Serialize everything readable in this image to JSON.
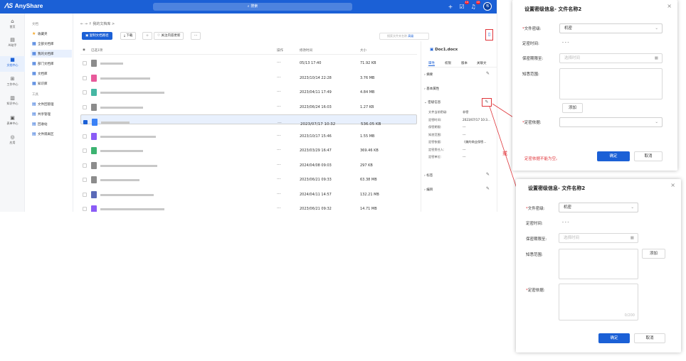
{
  "app": {
    "logo": "AnyShare",
    "search_placeholder": "搜索",
    "badges": [
      "14",
      "10"
    ],
    "avatar": "韦",
    "colors": {
      "brand": "#1b60d6",
      "highlight": "#e0353a"
    }
  },
  "rail": [
    {
      "label": "首页",
      "icon": "home-icon"
    },
    {
      "label": "AI助手",
      "icon": "ai-icon"
    },
    {
      "label": "文档中心",
      "icon": "folder-icon",
      "active": true
    },
    {
      "label": "工作中心",
      "icon": "grid-icon"
    },
    {
      "label": "知识中心",
      "icon": "book-icon"
    },
    {
      "label": "表单中心",
      "icon": "form-icon"
    },
    {
      "label": "应用",
      "icon": "apps-icon"
    }
  ],
  "tree": {
    "section_docs": "文档",
    "docs": [
      "收藏夹",
      "全部文档库",
      "我的文档库",
      "部门文档库",
      "文档库",
      "知识库"
    ],
    "active_index": 2,
    "section_tools": "工具",
    "tools": [
      "文件回管理",
      "共享管理",
      "回收站",
      "文件隔离区"
    ]
  },
  "main": {
    "breadcrumb": "我的文档库 >",
    "toolbar": {
      "new_label": "复制文档路径",
      "download_label": "下载",
      "follow_label": "关注内容更新",
      "more_label": "···"
    },
    "search_placeholder": "搜索文件夹名称",
    "search_adv": "高级",
    "columns": {
      "name": "已选1项",
      "op": "操作",
      "modified": "修改时间",
      "size": "大小"
    },
    "rows": [
      {
        "date": "05/13 17:40",
        "size": "71.92 KB",
        "color": "#8c8c8c",
        "w": 32
      },
      {
        "date": "2023/10/14 22:28",
        "size": "3.76 MB",
        "color": "#e85a9b",
        "w": 70
      },
      {
        "date": "2023/04/11 17:49",
        "size": "4.84 MB",
        "color": "#46b7a3",
        "w": 90
      },
      {
        "date": "2023/06/24 16:03",
        "size": "1.27 KB",
        "color": "#8c8c8c",
        "w": 60
      },
      {
        "date": "2023/07/17 10:32",
        "size": "536.05 KB",
        "color": "#3b82f6",
        "w": 40,
        "sel": true
      },
      {
        "date": "2023/10/17 15:46",
        "size": "1.55 MB",
        "color": "#8b5cf6",
        "w": 78
      },
      {
        "date": "2023/03/29 16:47",
        "size": "369.46 KB",
        "color": "#3cb371",
        "w": 60
      },
      {
        "date": "2024/04/08 09:03",
        "size": "297 KB",
        "color": "#8c8c8c",
        "w": 80
      },
      {
        "date": "2023/06/21 09:33",
        "size": "63.38 MB",
        "color": "#8c8c8c",
        "w": 55
      },
      {
        "date": "2024/04/11 14:57",
        "size": "132.21 MB",
        "color": "#5b6ab8",
        "w": 75
      },
      {
        "date": "2023/06/21 09:32",
        "size": "14.71 MB",
        "color": "#8b5cf6",
        "w": 90
      }
    ]
  },
  "detail": {
    "filename": "Doc1.docx",
    "tabs": [
      "属性",
      "权限",
      "版本",
      "关联文"
    ],
    "sections": {
      "summary": "摘要",
      "basic": "基本属性",
      "security": "密级信息",
      "tags": "标签",
      "catalog": "编目"
    },
    "kv": [
      {
        "k": "文件当前密级:",
        "v": "非密"
      },
      {
        "k": "定密时间:",
        "v": "2023/07/17 10:3..."
      },
      {
        "k": "保密期限:",
        "v": "---"
      },
      {
        "k": "知悉范围:",
        "v": "---"
      },
      {
        "k": "定密依据:",
        "v": "《美的商业保密..."
      },
      {
        "k": "定密责任人:",
        "v": "---"
      },
      {
        "k": "定密单位:",
        "v": "---"
      }
    ]
  },
  "annotation": {
    "or": "或"
  },
  "modal1": {
    "title": "设置密级信息- 文件名称2",
    "level_label": "文件密级:",
    "level_value": "机密",
    "time_label": "定密时间:",
    "time_value": "- - -",
    "period_label": "保密期限至:",
    "period_placeholder": "选择时间",
    "scope_label": "知悉范围:",
    "add_label": "添加",
    "basis_label": "定密依据:",
    "error": "定密依据不能为空。",
    "ok": "确定",
    "cancel": "取消"
  },
  "modal2": {
    "title": "设置密级信息- 文件名称2",
    "level_label": "文件密级:",
    "level_value": "机密",
    "time_label": "定密时间:",
    "time_value": "- - -",
    "period_label": "保密期限至:",
    "period_placeholder": "选择时间",
    "scope_label": "知悉范围:",
    "add_label": "添加",
    "basis_label": "定密依据:",
    "counter": "0/200",
    "ok": "确定",
    "cancel": "取消"
  }
}
